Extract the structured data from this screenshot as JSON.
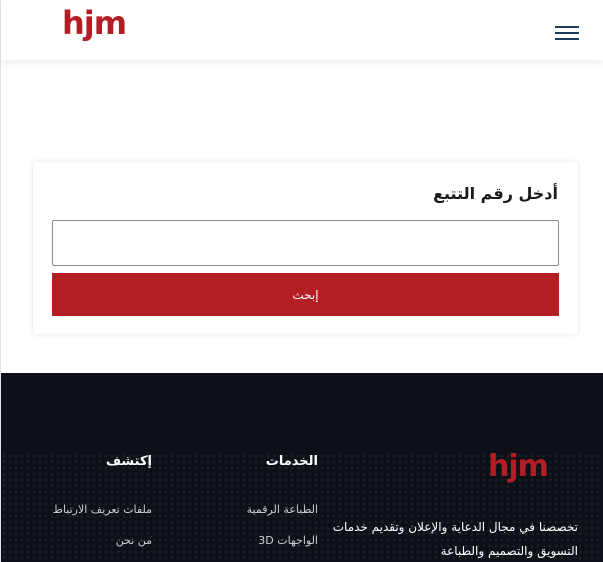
{
  "header": {
    "logo_text": "hjm",
    "menu_icon": "hamburger-menu-icon"
  },
  "tracking": {
    "title": "أدخل رقم التتبع",
    "input_value": "",
    "input_placeholder": "",
    "search_label": "إبحث"
  },
  "footer": {
    "logo_text": "hjm",
    "about_text": "تخصصنا في مجال الدعاية والإعلان وتقديم خدمات التسويق والتصميم والطباعة",
    "services": {
      "heading": "الخدمات",
      "items": [
        "الطباعة الرقمية",
        "الواجهات 3D"
      ]
    },
    "explore": {
      "heading": "إكتشف",
      "items": [
        "ملفات تعريف الارتباط",
        "من نحن"
      ]
    }
  },
  "colors": {
    "brand_red": "#b31e24",
    "footer_bg": "#0d1117",
    "menu_navy": "#1c3a5a"
  }
}
